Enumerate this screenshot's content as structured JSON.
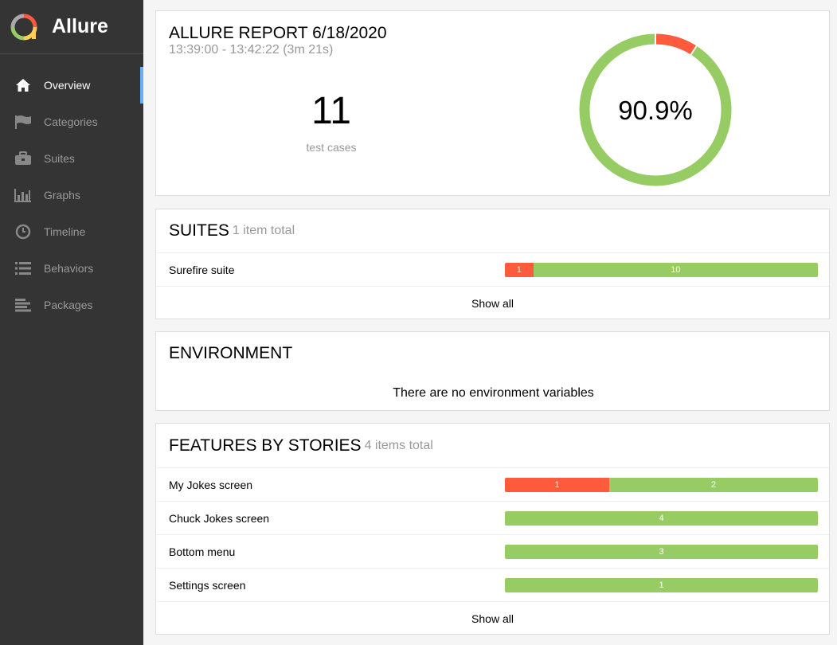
{
  "brand": {
    "name": "Allure",
    "logo_icon": "allure-logo-icon"
  },
  "sidebar": {
    "items": [
      {
        "label": "Overview",
        "icon": "home-icon",
        "active": true
      },
      {
        "label": "Categories",
        "icon": "flag-icon",
        "active": false
      },
      {
        "label": "Suites",
        "icon": "briefcase-icon",
        "active": false
      },
      {
        "label": "Graphs",
        "icon": "bar-chart-icon",
        "active": false
      },
      {
        "label": "Timeline",
        "icon": "clock-icon",
        "active": false
      },
      {
        "label": "Behaviors",
        "icon": "list-icon",
        "active": false
      },
      {
        "label": "Packages",
        "icon": "align-left-icon",
        "active": false
      }
    ]
  },
  "summary": {
    "title": "ALLURE REPORT 6/18/2020",
    "time_range": "13:39:00 - 13:42:22 (3m 21s)",
    "test_count": "11",
    "test_count_label": "test cases",
    "pass_rate": "90.9%",
    "donut": {
      "failed": 1,
      "passed": 10
    }
  },
  "suites": {
    "title": "SUITES",
    "count_label": "1 item total",
    "rows": [
      {
        "name": "Surefire suite",
        "failed": 1,
        "passed": 10,
        "failed_label": "1",
        "passed_label": "10"
      }
    ],
    "show_all": "Show all"
  },
  "environment": {
    "title": "ENVIRONMENT",
    "empty_message": "There are no environment variables"
  },
  "features": {
    "title": "FEATURES BY STORIES",
    "count_label": "4 items total",
    "rows": [
      {
        "name": "My Jokes screen",
        "failed": 1,
        "passed": 2,
        "failed_label": "1",
        "passed_label": "2"
      },
      {
        "name": "Chuck Jokes screen",
        "failed": 0,
        "passed": 4,
        "failed_label": "",
        "passed_label": "4"
      },
      {
        "name": "Bottom menu",
        "failed": 0,
        "passed": 3,
        "failed_label": "",
        "passed_label": "3"
      },
      {
        "name": "Settings screen",
        "failed": 0,
        "passed": 1,
        "failed_label": "",
        "passed_label": "1"
      }
    ],
    "show_all": "Show all"
  },
  "colors": {
    "failed": "#fd5a3e",
    "passed": "#97cc64",
    "sidebar": "#343434",
    "active_indicator": "#6aaef5"
  }
}
